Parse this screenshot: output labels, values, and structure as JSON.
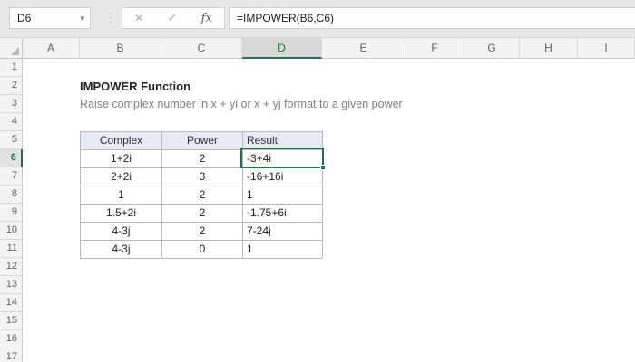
{
  "chrome": {
    "name_box_value": "D6",
    "formula": "=IMPOWER(B6,C6)",
    "fx_label": "fx",
    "cancel_icon": "✕",
    "confirm_icon": "✓",
    "dropdown_icon": "▾",
    "grip_icon": "⋮"
  },
  "grid": {
    "column_headers": [
      "A",
      "B",
      "C",
      "D",
      "E",
      "F",
      "G",
      "H",
      "I"
    ],
    "row_headers": [
      "1",
      "2",
      "3",
      "4",
      "5",
      "6",
      "7",
      "8",
      "9",
      "10",
      "11",
      "12",
      "13",
      "14",
      "15",
      "16",
      "17"
    ],
    "selected_cell": "D6",
    "selected_column": "D",
    "selected_row": "6"
  },
  "content": {
    "title": "IMPOWER Function",
    "subtitle": "Raise complex number in x + yi or x + yj format to a given power",
    "table": {
      "headers": [
        "Complex",
        "Power",
        "Result"
      ],
      "rows": [
        [
          "1+2i",
          "2",
          "-3+4i"
        ],
        [
          "2+2i",
          "3",
          "-16+16i"
        ],
        [
          "1",
          "2",
          "1"
        ],
        [
          "1.5+2i",
          "2",
          "-1.75+6i"
        ],
        [
          "4-3j",
          "2",
          "7-24j"
        ],
        [
          "4-3j",
          "0",
          "1"
        ]
      ]
    }
  },
  "colors": {
    "accent_green": "#217346",
    "table_header_fill": "#E9E9F5",
    "table_border": "#B8B8C8",
    "chrome_background": "#E8E8E8"
  }
}
